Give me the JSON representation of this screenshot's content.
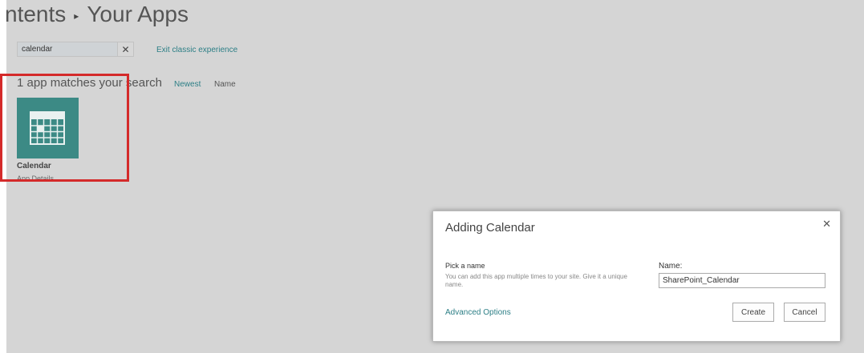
{
  "breadcrumb": {
    "parent": "ntents",
    "separator": "▸",
    "current": "Your Apps"
  },
  "search": {
    "value": "calendar",
    "clear_icon": "✕"
  },
  "exit_link": "Exit classic experience",
  "results": {
    "title": "1 app matches your search",
    "sort_newest": "Newest",
    "sort_name": "Name"
  },
  "app": {
    "name": "Calendar",
    "details": "App Details",
    "tile_color": "#3c8a85",
    "icon": "calendar-icon"
  },
  "highlight_color": "#d42a2a",
  "dialog": {
    "title": "Adding Calendar",
    "close_icon": "✕",
    "pick_title": "Pick a name",
    "pick_desc": "You can add this app multiple times to your site. Give it a unique name.",
    "name_label": "Name:",
    "name_value": "SharePoint_Calendar",
    "advanced_link": "Advanced Options",
    "create_label": "Create",
    "cancel_label": "Cancel"
  }
}
